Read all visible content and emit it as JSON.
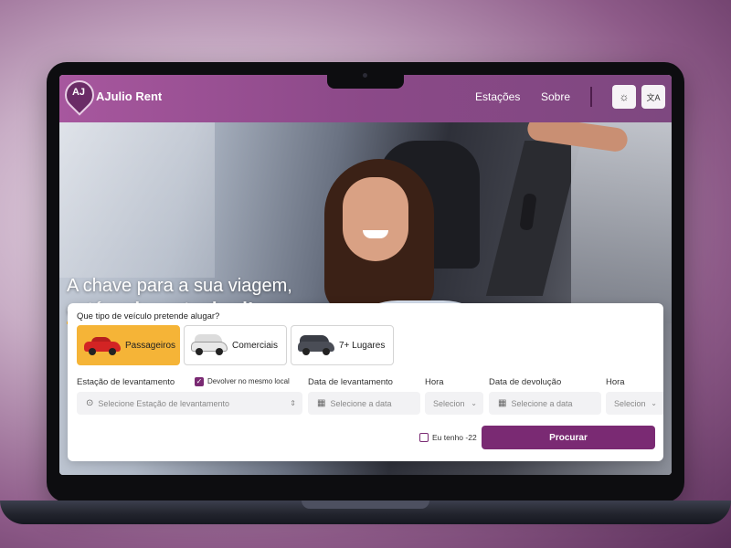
{
  "header": {
    "logo_text": "AJ",
    "brand": "AJulio Rent",
    "nav": [
      "Estações",
      "Sobre"
    ],
    "theme_icon": "☼",
    "translate_icon": "文A"
  },
  "hero": {
    "headline_line1": "A chave para a sua viagem,",
    "headline_line2": "está mais perto de si!"
  },
  "search": {
    "question": "Que tipo de veículo pretende alugar?",
    "vehicle_types": [
      {
        "label": "Passageiros",
        "active": true
      },
      {
        "label": "Comerciais",
        "active": false
      },
      {
        "label": "7+ Lugares",
        "active": false
      }
    ],
    "pickup_station_label": "Estação de levantamento",
    "same_location_label": "Devolver no mesmo local",
    "same_location_checked": true,
    "pickup_date_label": "Data de levantamento",
    "pickup_hour_label": "Hora",
    "return_date_label": "Data de devolução",
    "return_hour_label": "Hora",
    "station_placeholder": "Selecione Estação de levantamento",
    "date_placeholder": "Selecione a data",
    "hour_placeholder": "Selecion",
    "age_label": "Eu tenho -22",
    "submit_label": "Procurar"
  },
  "colors": {
    "brand_purple": "#7a2a73",
    "accent_yellow": "#f5b437"
  }
}
